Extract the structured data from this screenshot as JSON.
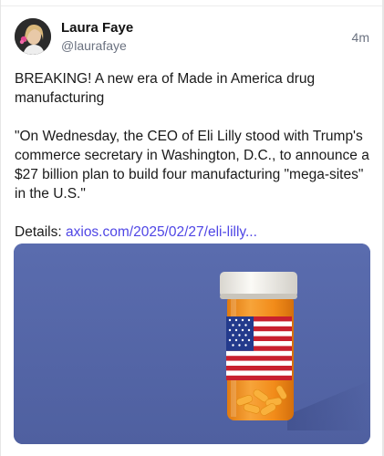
{
  "post": {
    "author": {
      "name": "Laura Faye",
      "handle": "@laurafaye",
      "avatar_icon": "profile-photo-icon"
    },
    "timestamp": "4m",
    "headline": "BREAKING! A new era of Made in America drug manufacturing",
    "quote": "\"On Wednesday, the CEO of Eli Lilly stood with Trump's commerce secretary in Washington, D.C., to announce a $27 billion plan to build four manufacturing \"mega-sites\" in the U.S.\"",
    "details_label": "Details:",
    "details_link": "axios.com/2025/02/27/eli-lilly...",
    "media": {
      "icon": "pill-bottle-american-flag-image",
      "background_color": "#5667a8",
      "bottle_color": "#f28c1a",
      "cap_color": "#f5f3ee",
      "pill_color": "#f6a21e"
    }
  },
  "colors": {
    "text": "#1a1a1a",
    "muted": "#6b7280",
    "link": "#4f46e5"
  }
}
